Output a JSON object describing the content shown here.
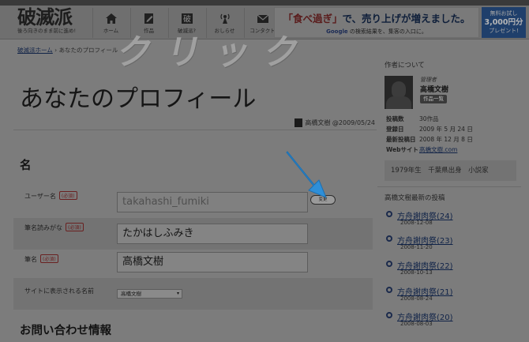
{
  "header": {
    "logo_text": "破滅派",
    "logo_tagline": "後ろ向きのまま前に進め!",
    "nav": [
      {
        "label": "ホーム",
        "icon": "home-icon"
      },
      {
        "label": "作品",
        "icon": "pencil-icon"
      },
      {
        "label": "破滅派?",
        "icon": "brand-icon"
      },
      {
        "label": "おしらせ",
        "icon": "broadcast-icon"
      },
      {
        "label": "コンタクト",
        "icon": "mail-icon"
      }
    ],
    "banner_line1_a": "「食べ過ぎ」",
    "banner_line1_b": "で、売り上げが増えました。",
    "banner_line2_a": "Google",
    "banner_line2_b": " の検索結果を、集客の入口に。",
    "promo": [
      "無料お試し",
      "3,000円分",
      "プレゼント!"
    ]
  },
  "breadcrumb": {
    "home": "破滅派ホーム",
    "sep": " › ",
    "current": "あなたのプロフィール"
  },
  "page": {
    "title": "あなたのプロフィール",
    "author": "高橋文樹",
    "date": "@2009/05/24",
    "overlay_text": "クリック"
  },
  "form": {
    "section_name": "名",
    "section_contact": "お問い合わせ情報",
    "required": "(必須)",
    "username_label": "ユーザー名",
    "username_value": "takahashi_fumiki",
    "change_button": "変更",
    "kana_label": "筆名読みがな",
    "kana_value": "たかはしふみき",
    "penname_label": "筆名",
    "penname_value": "高橋文樹",
    "display_label": "サイトに表示される名前",
    "display_value": "高橋文樹"
  },
  "sidebar": {
    "about_heading": "作者について",
    "role": "管理者",
    "name": "高橋文樹",
    "works_button": "作品一覧",
    "info": [
      {
        "key": "投稿数",
        "value": "30作品"
      },
      {
        "key": "登録日",
        "value": "2009 年 5 月 24 日"
      },
      {
        "key": "最新投稿日",
        "value": "2008 年 12 月 8 日"
      },
      {
        "key": "Webサイト",
        "value": "高橋文樹.com"
      }
    ],
    "bio": "1979年生　千葉県出身　小説家",
    "recent_heading": "高橋文樹最新の投稿",
    "posts": [
      {
        "title": "方舟謝肉祭(24)",
        "date": "2008-12-08"
      },
      {
        "title": "方舟謝肉祭(23)",
        "date": "2008-11-20"
      },
      {
        "title": "方舟謝肉祭(22)",
        "date": "2008-10-13"
      },
      {
        "title": "方舟謝肉祭(21)",
        "date": "2008-08-24"
      },
      {
        "title": "方舟謝肉祭(20)",
        "date": "2008-08-03"
      }
    ]
  },
  "colors": {
    "overlay_dim": "#7c7c7c",
    "arrow": "#2e8fd8",
    "link": "#122448"
  }
}
